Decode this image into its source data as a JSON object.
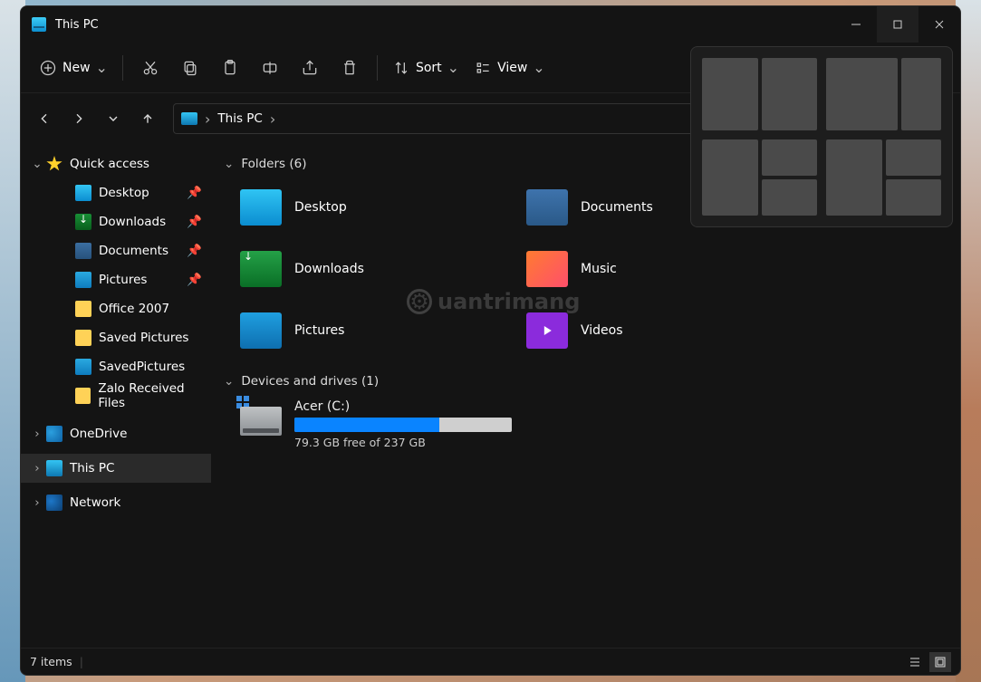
{
  "window": {
    "title": "This PC"
  },
  "toolbar": {
    "new_label": "New",
    "sort_label": "Sort",
    "view_label": "View"
  },
  "address": {
    "crumb1": "This PC"
  },
  "sidebar": {
    "quick_access": "Quick access",
    "items": [
      {
        "label": "Desktop"
      },
      {
        "label": "Downloads"
      },
      {
        "label": "Documents"
      },
      {
        "label": "Pictures"
      },
      {
        "label": "Office 2007"
      },
      {
        "label": "Saved Pictures"
      },
      {
        "label": "SavedPictures"
      },
      {
        "label": "Zalo Received Files"
      }
    ],
    "onedrive": "OneDrive",
    "this_pc": "This PC",
    "network": "Network"
  },
  "groups": {
    "folders_header": "Folders (6)",
    "drives_header": "Devices and drives (1)"
  },
  "folders": [
    {
      "label": "Desktop"
    },
    {
      "label": "Documents"
    },
    {
      "label": "Downloads"
    },
    {
      "label": "Music"
    },
    {
      "label": "Pictures"
    },
    {
      "label": "Videos"
    }
  ],
  "drive": {
    "name": "Acer (C:)",
    "free_text": "79.3 GB free of 237 GB",
    "fill_percent": 66.5
  },
  "statusbar": {
    "items_text": "7 items"
  },
  "watermark": "uantrimang"
}
